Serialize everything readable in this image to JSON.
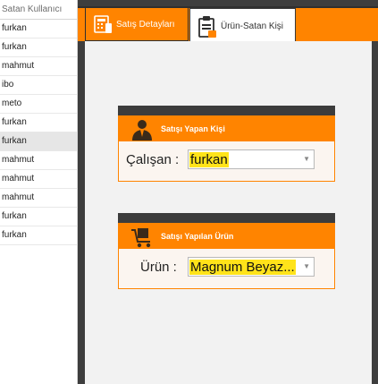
{
  "list": {
    "header": "Satan Kullanıcı",
    "rows": [
      "furkan",
      "furkan",
      "mahmut",
      "ibo",
      "meto",
      "furkan",
      "furkan",
      "mahmut",
      "mahmut",
      "mahmut",
      "furkan",
      "furkan"
    ],
    "selected_index": 6
  },
  "tabs": [
    {
      "label": "Satış Detayları",
      "icon": "register-icon"
    },
    {
      "label": "Ürün-Satan Kişi",
      "icon": "clipboard-icon"
    }
  ],
  "active_tab": 1,
  "seller_group": {
    "title": "Satışı Yapan Kişi",
    "icon": "person-icon",
    "field_label": "Çalışan :",
    "value": "furkan"
  },
  "product_group": {
    "title": "Satışı Yapılan Ürün",
    "icon": "cart-icon",
    "field_label": "Ürün :",
    "value": "Magnum Beyaz..."
  },
  "colors": {
    "accent": "#ff8400",
    "dark": "#3e3e3e",
    "highlight": "#ffe31a"
  }
}
